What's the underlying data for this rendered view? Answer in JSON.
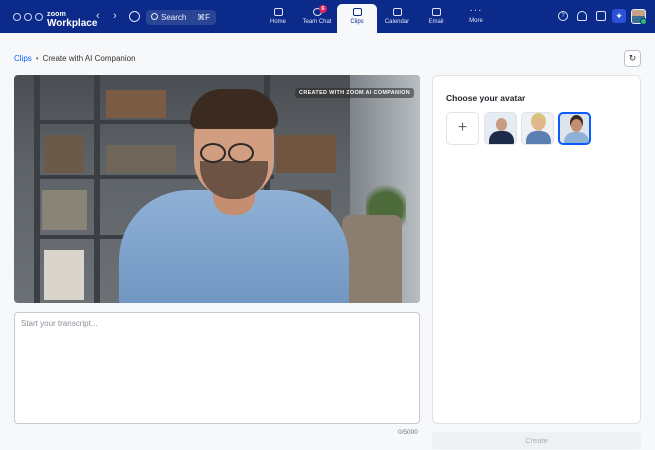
{
  "app": {
    "brand_small": "zoom",
    "brand_large": "Workplace"
  },
  "search": {
    "label": "Search",
    "shortcut": "⌘F"
  },
  "tabs": [
    {
      "label": "Home",
      "icon": "home-icon"
    },
    {
      "label": "Team Chat",
      "icon": "chat-icon",
      "badge": "6"
    },
    {
      "label": "Clips",
      "icon": "clips-icon",
      "active": true
    },
    {
      "label": "Calendar",
      "icon": "calendar-icon"
    },
    {
      "label": "Email",
      "icon": "email-icon"
    },
    {
      "label": "More",
      "icon": "more-icon"
    }
  ],
  "breadcrumb": {
    "root": "Clips",
    "current": "Create with AI Companion"
  },
  "video": {
    "watermark": "CREATED WITH ZOOM AI COMPANION"
  },
  "transcript": {
    "placeholder": "Start your transcript...",
    "counter": "0/5000"
  },
  "avatar_panel": {
    "title": "Choose your avatar",
    "add_symbol": "+"
  },
  "create_button": "Create",
  "colors": {
    "topbar": "#0b2a8a",
    "accent": "#0b5cff",
    "badge": "#e0245e"
  }
}
